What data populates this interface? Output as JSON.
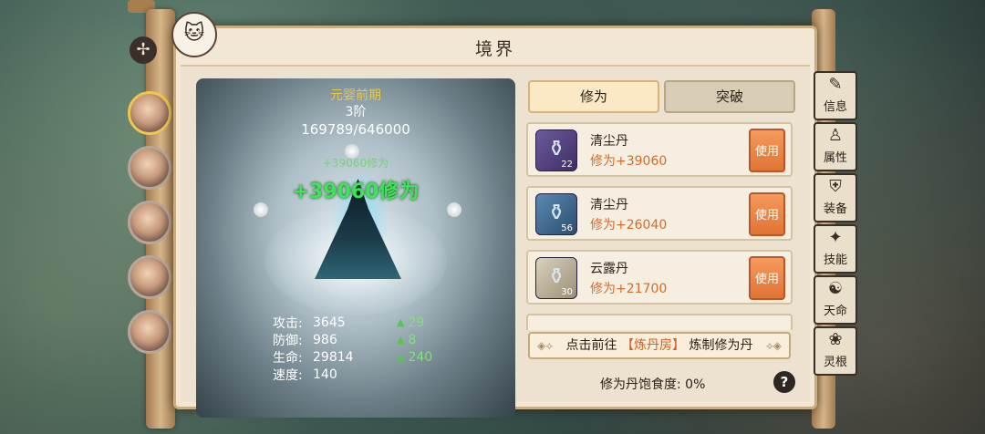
{
  "panel": {
    "title": "境界"
  },
  "realm": {
    "name": "元婴前期",
    "stage": "3阶",
    "exp": "169789/646000",
    "gain_faded": "+39060修为",
    "gain": "+39060修为"
  },
  "stats": [
    {
      "label": "攻击:",
      "value": "3645",
      "bonus": "29"
    },
    {
      "label": "防御:",
      "value": "986",
      "bonus": "8"
    },
    {
      "label": "生命:",
      "value": "29814",
      "bonus": "240"
    },
    {
      "label": "速度:",
      "value": "140",
      "bonus": ""
    }
  ],
  "tabs": {
    "cultivate": "修为",
    "breakthrough": "突破"
  },
  "pills": [
    {
      "name": "清尘丹",
      "effect": "修为+39060",
      "count": "22",
      "button": "使用",
      "icon": "purple-bottle-icon"
    },
    {
      "name": "清尘丹",
      "effect": "修为+26040",
      "count": "56",
      "button": "使用",
      "icon": "blue-bottle-icon"
    },
    {
      "name": "云露丹",
      "effect": "修为+21700",
      "count": "30",
      "button": "使用",
      "icon": "white-bottle-icon"
    }
  ],
  "forge": {
    "prefix": "点击前往",
    "place": "【炼丹房】",
    "suffix": "炼制修为丹"
  },
  "satiety": {
    "label": "修为丹饱食度:",
    "value": "0%"
  },
  "help": "?",
  "side_menu": [
    "信息",
    "属性",
    "装备",
    "技能",
    "天命",
    "灵根"
  ],
  "colors": {
    "accent_orange": "#e07434",
    "gain_green": "#3fe35a",
    "realm_gold": "#e6c74f"
  }
}
